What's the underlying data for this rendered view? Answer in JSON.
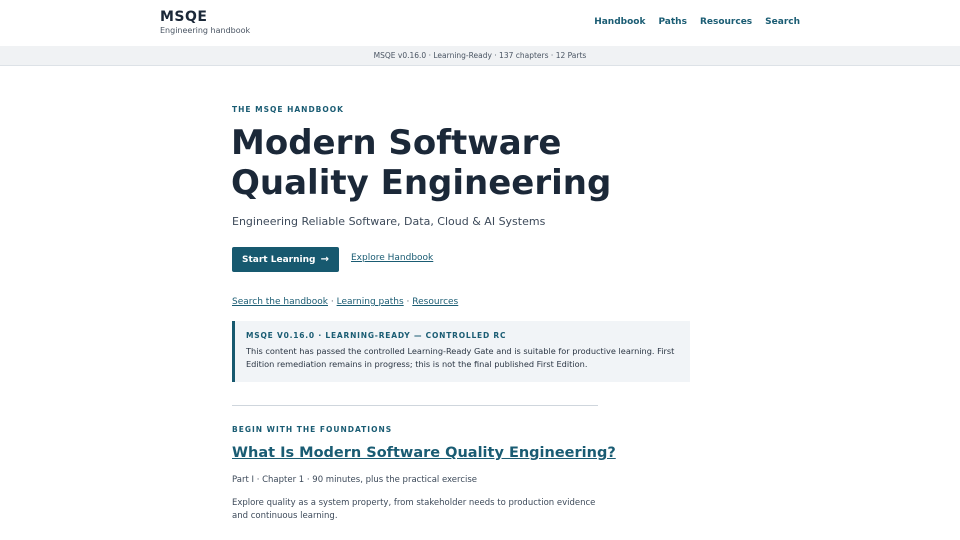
{
  "header": {
    "brand_title": "MSQE",
    "brand_subtitle": "Engineering handbook",
    "nav": [
      "Handbook",
      "Paths",
      "Resources",
      "Search"
    ]
  },
  "status_bar": {
    "text": "MSQE v0.16.0 · Learning-Ready · 137 chapters · 12 Parts"
  },
  "hero": {
    "eyebrow": "THE MSQE HANDBOOK",
    "title": "Modern Software Quality Engineering",
    "subtitle": "Engineering Reliable Software, Data, Cloud & AI Systems",
    "primary_button": "Start Learning",
    "primary_button_icon": "arrow-right-icon",
    "secondary_link": "Explore Handbook"
  },
  "quick_links": [
    "Search the handbook",
    "Learning paths",
    "Resources"
  ],
  "quick_links_separator": " · ",
  "notice": {
    "title": "MSQE V0.16.0 · LEARNING-READY — CONTROLLED RC",
    "body": "This content has passed the controlled Learning-Ready Gate and is suitable for productive learning. First Edition remediation remains in progress; this is not the final published First Edition."
  },
  "foundations": {
    "eyebrow": "BEGIN WITH THE FOUNDATIONS",
    "chapter_title": "What Is Modern Software Quality Engineering?",
    "chapter_meta": "Part I · Chapter 1 · 90 minutes, plus the practical exercise",
    "chapter_description": "Explore quality as a system property, from stakeholder needs to production evidence and continuous learning."
  },
  "colors": {
    "accent": "#17596f",
    "text_dark": "#1b2838",
    "status_bar_bg": "#f0f2f4",
    "notice_bg": "#f1f4f7"
  }
}
